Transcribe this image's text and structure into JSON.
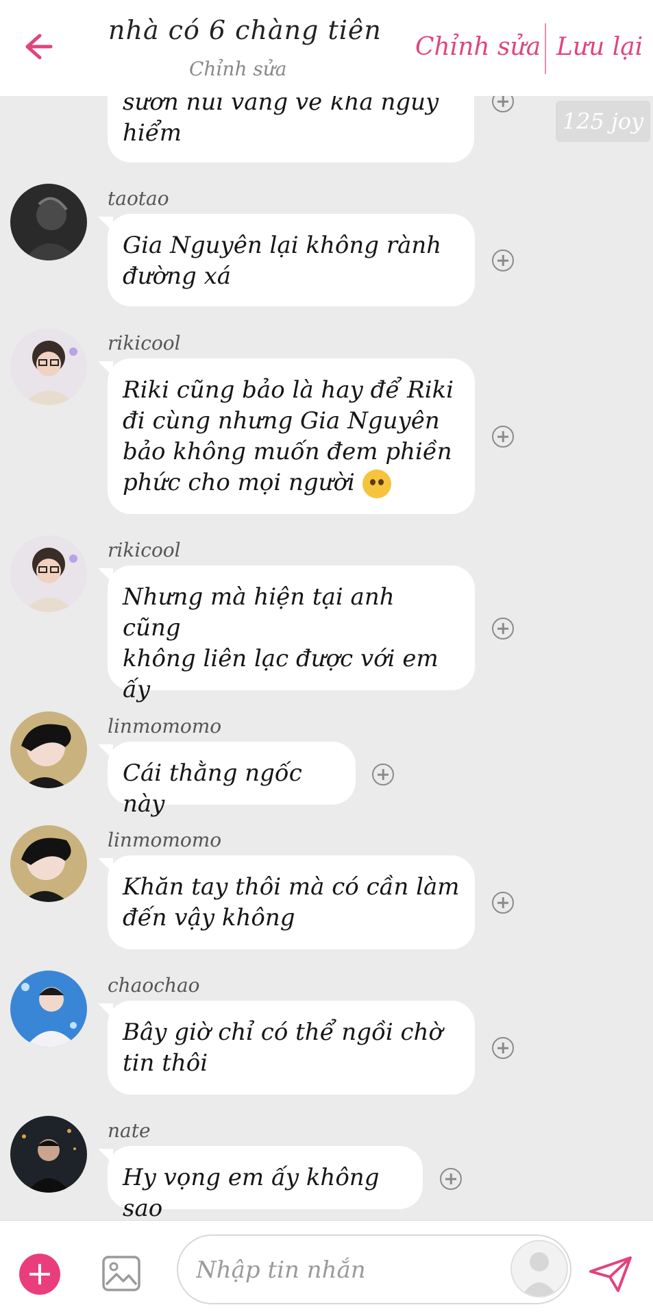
{
  "header": {
    "title": "nhà có 6 chàng tiên",
    "subtitle": "Chỉnh sửa",
    "edit_label": "Chỉnh sửa",
    "save_label": "Lưu lại",
    "back_icon": "arrow-left-icon"
  },
  "joy_badge": "125 joy",
  "messages": [
    {
      "user": "",
      "lines": [
        "sườn núi vàng về khá nguy",
        "hiểm"
      ],
      "emoji": false
    },
    {
      "user": "taotao",
      "lines": [
        "Gia Nguyên lại không rành",
        "đường xá"
      ],
      "emoji": false
    },
    {
      "user": "rikicool",
      "lines": [
        "Riki cũng bảo là hay để Riki",
        "đi cùng nhưng Gia Nguyên",
        "bảo không muốn đem phiền",
        "phức cho mọi người"
      ],
      "emoji": true
    },
    {
      "user": "rikicool",
      "lines": [
        "Nhưng mà hiện tại anh cũng",
        "không liên lạc được với em",
        "ấy"
      ],
      "emoji": false
    },
    {
      "user": "linmomomo",
      "lines": [
        "Cái thằng ngốc này"
      ],
      "emoji": false
    },
    {
      "user": "linmomomo",
      "lines": [
        "Khăn tay thôi mà có cần làm",
        "đến vậy không"
      ],
      "emoji": false
    },
    {
      "user": "chaochao",
      "lines": [
        "Bây giờ chỉ có thể ngồi chờ",
        "tin thôi"
      ],
      "emoji": false
    },
    {
      "user": "nate",
      "lines": [
        "Hy vọng em ấy không sao"
      ],
      "emoji": false
    }
  ],
  "composer": {
    "placeholder": "Nhập tin nhắn",
    "add_icon": "plus-circle-icon",
    "image_icon": "image-icon",
    "sticker_icon": "avatar-sticker-icon",
    "send_icon": "send-icon"
  },
  "colors": {
    "accent": "#e0447f",
    "background": "#ebebeb",
    "bubble": "#ffffff"
  }
}
